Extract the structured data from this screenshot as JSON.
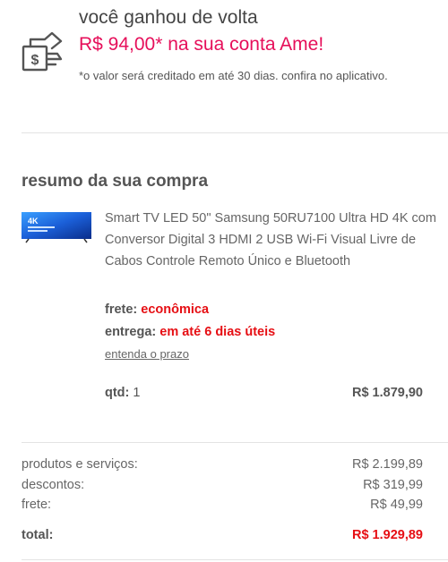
{
  "cashback": {
    "title": "você ganhou de volta",
    "amount": "R$ 94,00* na sua conta Ame!",
    "note": "*o valor será creditado em até 30 dias. confira no aplicativo.",
    "icon": "hand-money-icon"
  },
  "summary": {
    "title": "resumo da sua compra"
  },
  "product": {
    "thumbnail_icon": "tv-thumbnail",
    "thumbnail_text": "4K",
    "description": "Smart TV LED 50\" Samsung 50RU7100 Ultra HD 4K com Conversor Digital 3 HDMI 2 USB Wi-Fi Visual Livre de Cabos Controle Remoto Único e Bluetooth",
    "freight_label": "frete:",
    "freight_value": "econômica",
    "delivery_label": "entrega:",
    "delivery_value": "em até 6 dias úteis",
    "prazo_link": "entenda o prazo",
    "qty_label": "qtd:",
    "qty_value": "1",
    "price": "R$ 1.879,90"
  },
  "totals": {
    "products_label": "produtos e serviços:",
    "products_value": "R$ 2.199,89",
    "discounts_label": "descontos:",
    "discounts_value": "R$ 319,99",
    "freight_label": "frete:",
    "freight_value": "R$ 49,99",
    "total_label": "total:",
    "total_value": "R$ 1.929,89"
  },
  "colors": {
    "accent_pink": "#e60f5a",
    "accent_red": "#e60f14",
    "text": "#555555",
    "divider": "#e3e3e3"
  }
}
